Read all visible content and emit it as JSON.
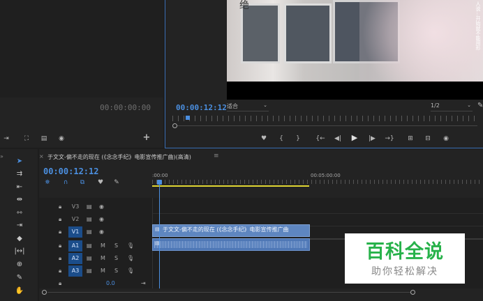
{
  "source_monitor": {
    "timecode": "00:00:00:00",
    "controls": [
      "insert",
      "overwrite",
      "export-frame",
      "add"
    ]
  },
  "program_monitor": {
    "video_overlay_text_left": "绝",
    "video_overlay_text_right_1": "人说…开始就不能用形",
    "timecode": "00:00:12:12",
    "fit_select": "适合",
    "resolution_select": "1/2",
    "transport": [
      "marker",
      "in",
      "out",
      "go-to-in",
      "step-back",
      "play",
      "step-forward",
      "go-to-out",
      "lift",
      "extract",
      "export-frame"
    ]
  },
  "timeline": {
    "close_glyph": "×",
    "sequence_name": "于文文-偏不走的现在 (《念念手纪》电影宣传推广曲)(高清)",
    "menu_glyph": "≡",
    "timecode": "00:00:12:12",
    "ruler_start": ":00:00",
    "ruler_mark": "00:05:00:00",
    "tracks": [
      {
        "name": "V3",
        "active": false,
        "type": "video"
      },
      {
        "name": "V2",
        "active": false,
        "type": "video"
      },
      {
        "name": "V1",
        "active": true,
        "type": "video"
      },
      {
        "name": "A1",
        "active": true,
        "type": "audio"
      },
      {
        "name": "A2",
        "active": true,
        "type": "audio"
      },
      {
        "name": "A3",
        "active": true,
        "type": "audio"
      }
    ],
    "track_m": "M",
    "track_s": "S",
    "master_volume": "0.0",
    "clip_label": "于文文-偏不走的现在 (《念念手纪》电影宣传推广曲"
  },
  "watermark": {
    "title": "百科全说",
    "subtitle": "助你轻松解决"
  },
  "colors": {
    "accent": "#4b8fe0",
    "work_area": "#e0d632",
    "clip_video": "#5e86c0",
    "clip_audio": "#4e77b5"
  }
}
